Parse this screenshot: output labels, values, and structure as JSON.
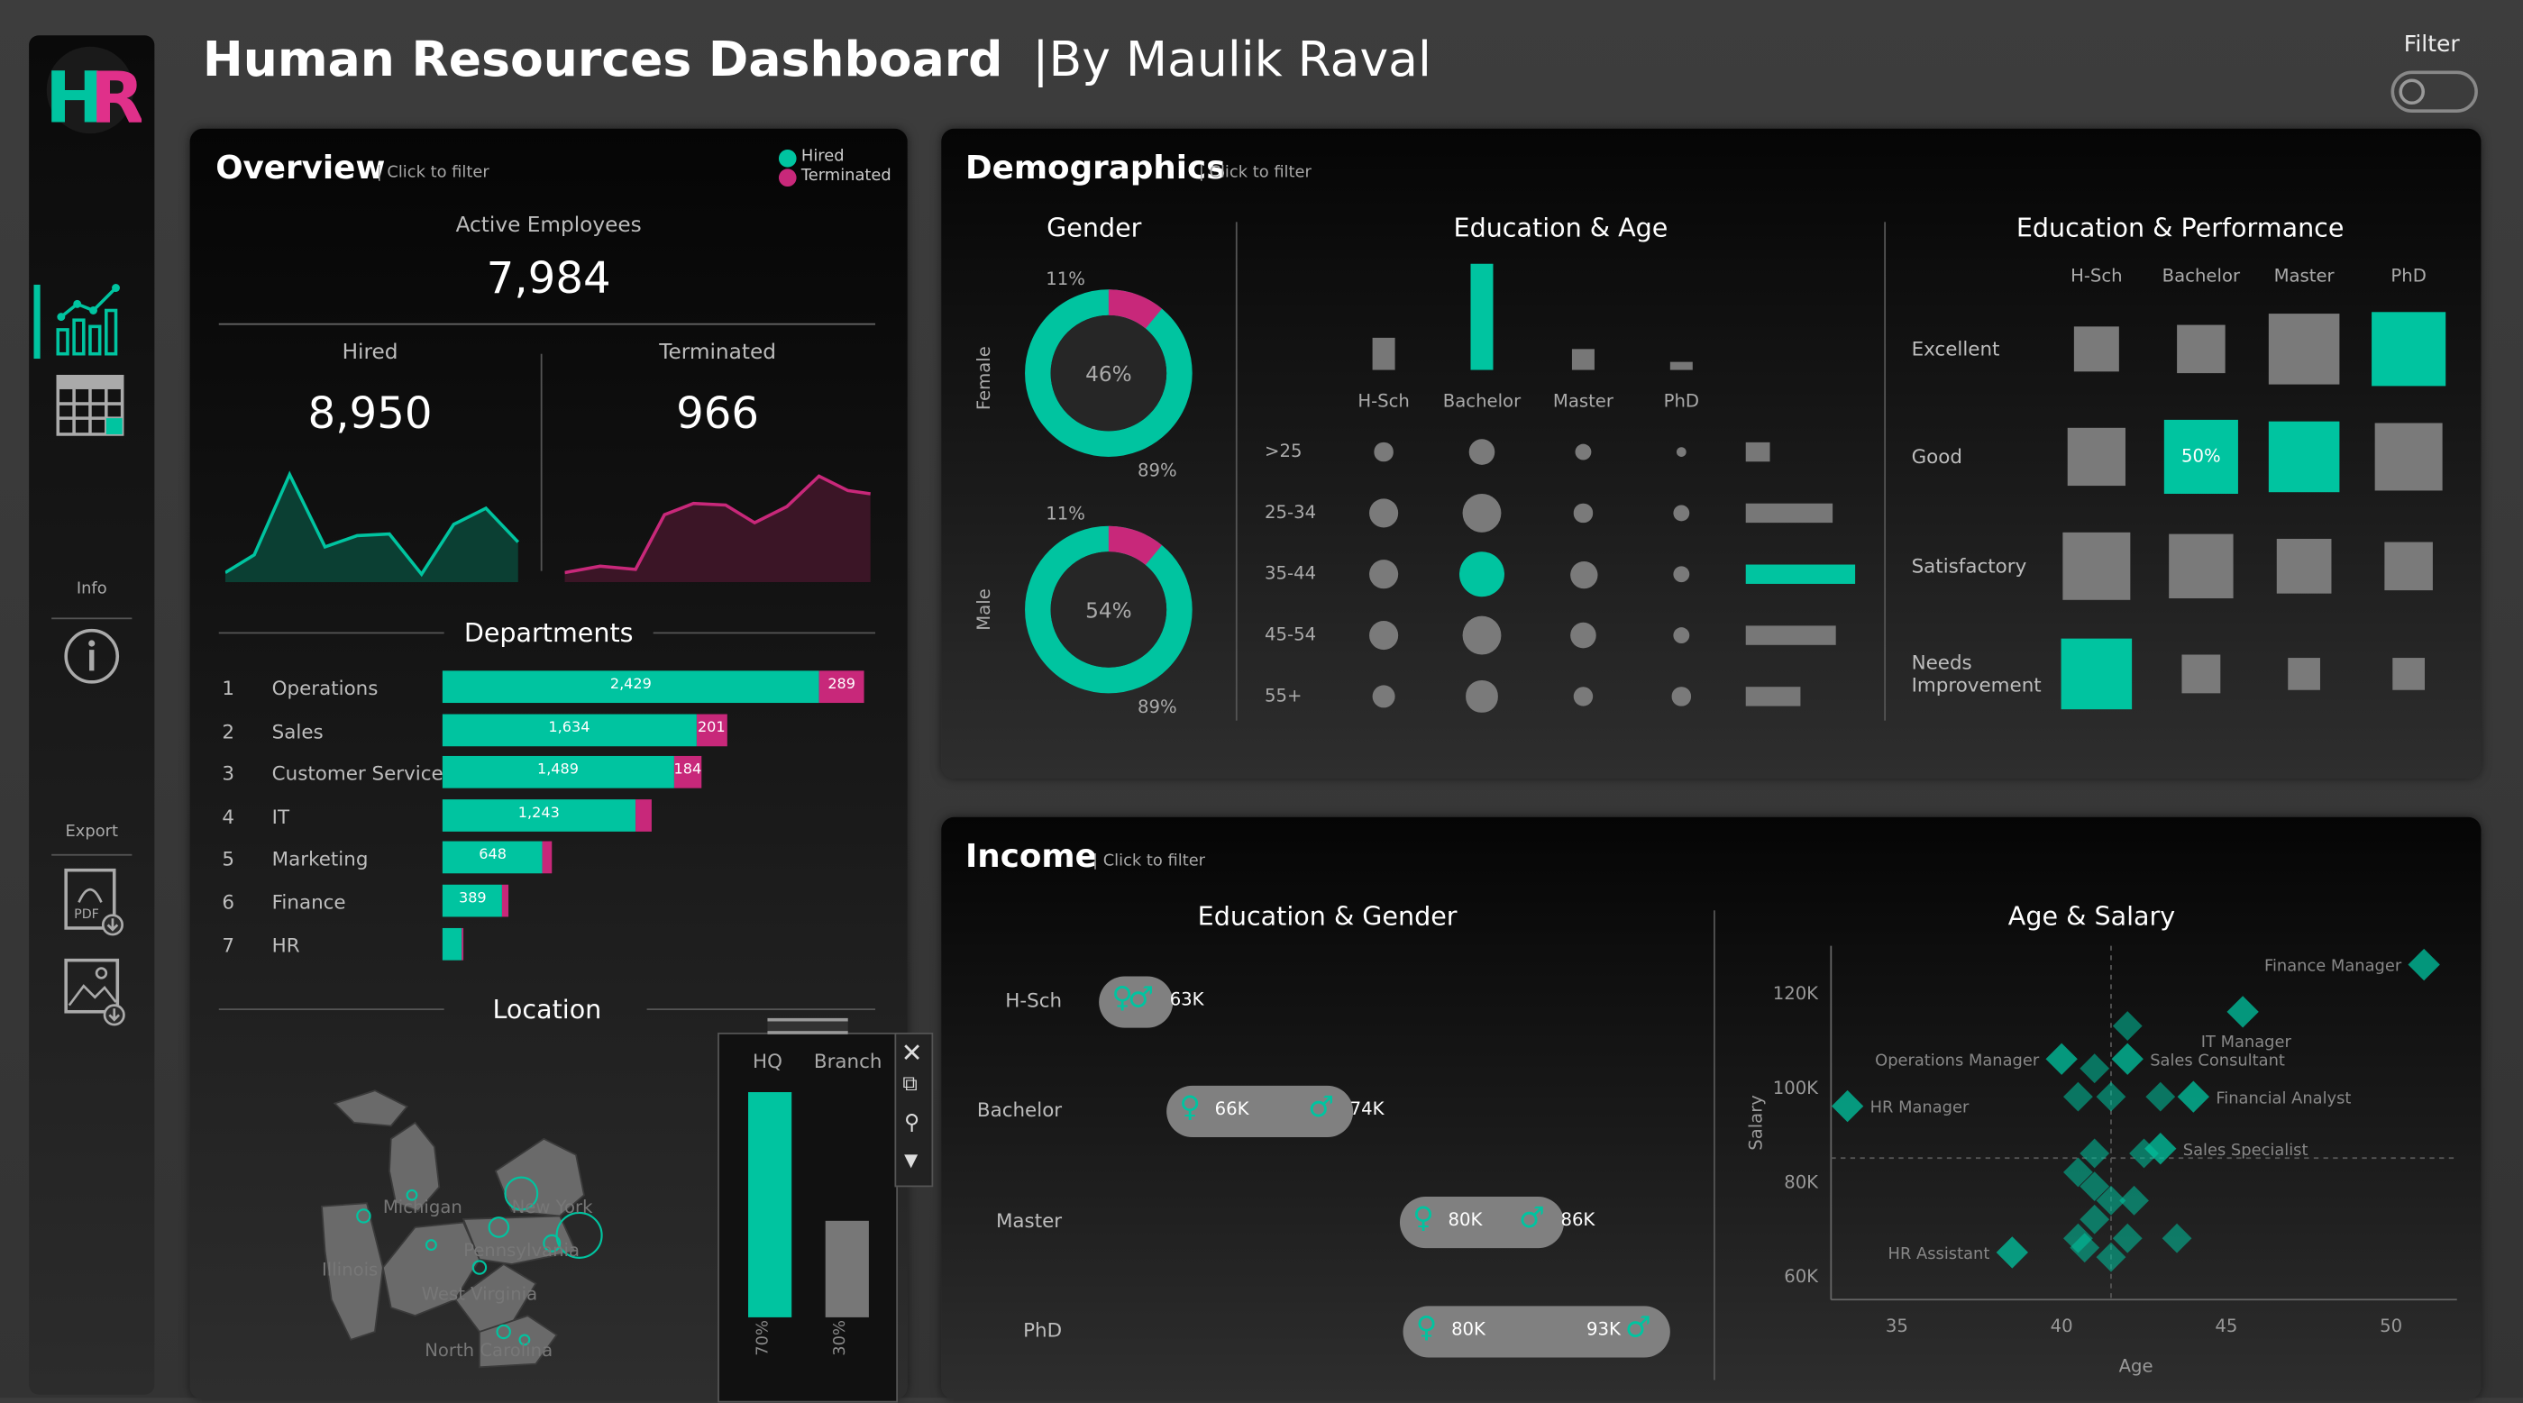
{
  "header": {
    "title": "Human Resources Dashboard",
    "byline": "|By Maulik Raval",
    "filter_label": "Filter"
  },
  "sidebar": {
    "logo_text": "HR",
    "info_label": "Info",
    "export_label": "Export"
  },
  "colors": {
    "teal": "#00c4a0",
    "pink": "#c8287a",
    "grey": "#777777"
  },
  "overview": {
    "title": "Overview",
    "hint": "| Click to filter",
    "legend": {
      "hired": "Hired",
      "terminated": "Terminated"
    },
    "active_label": "Active Employees",
    "active_value": "7,984",
    "hired_label": "Hired",
    "hired_value": "8,950",
    "terminated_label": "Terminated",
    "terminated_value": "966",
    "departments_label": "Departments",
    "departments": [
      {
        "rank": "1",
        "name": "Operations",
        "hired": "2,429",
        "terminated": "289",
        "hired_n": 2429,
        "term_n": 289
      },
      {
        "rank": "2",
        "name": "Sales",
        "hired": "1,634",
        "terminated": "201",
        "hired_n": 1634,
        "term_n": 201
      },
      {
        "rank": "3",
        "name": "Customer Service",
        "hired": "1,489",
        "terminated": "184",
        "hired_n": 1489,
        "term_n": 184
      },
      {
        "rank": "4",
        "name": "IT",
        "hired": "1,243",
        "terminated": "",
        "hired_n": 1243,
        "term_n": 110
      },
      {
        "rank": "5",
        "name": "Marketing",
        "hired": "648",
        "terminated": "",
        "hired_n": 648,
        "term_n": 55
      },
      {
        "rank": "6",
        "name": "Finance",
        "hired": "389",
        "terminated": "",
        "hired_n": 389,
        "term_n": 40
      },
      {
        "rank": "7",
        "name": "HR",
        "hired": "",
        "terminated": "",
        "hired_n": 120,
        "term_n": 20
      }
    ],
    "location_label": "Location",
    "location": {
      "hq_label": "HQ",
      "branch_label": "Branch",
      "hq_pct": "70%",
      "branch_pct": "30%",
      "hq_value": 0.7,
      "branch_value": 0.3
    },
    "map_labels": [
      "Michigan",
      "New York",
      "Illinois",
      "Pennsylvania",
      "West Virginia",
      "North Carolina"
    ]
  },
  "demographics": {
    "title": "Demographics",
    "hint": "| Click to filter",
    "gender": {
      "title": "Gender",
      "female": {
        "label": "Female",
        "center": "46%",
        "top": "11%",
        "bottom": "89%",
        "share": 0.11
      },
      "male": {
        "label": "Male",
        "center": "54%",
        "top": "11%",
        "bottom": "89%",
        "share": 0.11
      }
    },
    "edu_age": {
      "title": "Education & Age",
      "education": [
        "H-Sch",
        "Bachelor",
        "Master",
        "PhD"
      ],
      "ages": [
        ">25",
        "25-34",
        "35-44",
        "45-54",
        "55+"
      ],
      "edu_bar_values": [
        0.3,
        1.0,
        0.2,
        0.08
      ],
      "bubble_sizes": [
        [
          0.25,
          0.45,
          0.2,
          0
        ],
        [
          0.55,
          0.85,
          0.25,
          0.2
        ],
        [
          0.55,
          1.0,
          0.5,
          0.2
        ],
        [
          0.55,
          0.85,
          0.45,
          0.2
        ],
        [
          0.4,
          0.6,
          0.3,
          0.25
        ]
      ],
      "highlight": [
        2,
        1
      ],
      "age_bar_values": [
        0.22,
        0.8,
        1.0,
        0.82,
        0.5
      ]
    },
    "edu_perf": {
      "title": "Education & Performance",
      "education": [
        "H-Sch",
        "Bachelor",
        "Master",
        "PhD"
      ],
      "ratings": [
        "Excellent",
        "Good",
        "Satisfactory",
        "Needs\nImprovement"
      ],
      "rating_lines": [
        [
          "Excellent"
        ],
        [
          "Good"
        ],
        [
          "Satisfactory"
        ],
        [
          "Needs",
          "Improvement"
        ]
      ],
      "cells": [
        [
          0.55,
          0.6,
          0.95,
          1.0
        ],
        [
          0.75,
          1.0,
          0.95,
          0.92
        ],
        [
          0.92,
          0.85,
          0.7,
          0.6
        ],
        [
          0.95,
          0.4,
          0.3,
          0.3
        ]
      ],
      "teal_cells": [
        [
          0,
          3
        ],
        [
          1,
          1
        ],
        [
          1,
          2
        ],
        [
          3,
          0
        ]
      ],
      "highlight_label": "50%"
    }
  },
  "income": {
    "title": "Income",
    "hint": "| Click to filter",
    "edu_gender": {
      "title": "Education & Gender",
      "rows": [
        {
          "label": "H-Sch",
          "first": "",
          "second": "63K"
        },
        {
          "label": "Bachelor",
          "first": "66K",
          "second": "74K"
        },
        {
          "label": "Master",
          "first": "80K",
          "second": "86K"
        },
        {
          "label": "PhD",
          "first": "80K",
          "second": "93K"
        }
      ]
    },
    "age_salary": {
      "title": "Age & Salary",
      "xlabel": "Age",
      "ylabel": "Salary",
      "x_ticks": [
        "35",
        "40",
        "45",
        "50"
      ],
      "y_ticks": [
        "120K",
        "100K",
        "80K",
        "60K"
      ],
      "xlim": [
        33,
        52
      ],
      "ylim": [
        55,
        130
      ],
      "labeled_points": [
        {
          "name": "Finance Manager",
          "x": 51,
          "y": 126
        },
        {
          "name": "IT Manager",
          "x": 45.5,
          "y": 116
        },
        {
          "name": "Operations Manager",
          "x": 40,
          "y": 106
        },
        {
          "name": "Sales Consultant",
          "x": 42,
          "y": 106
        },
        {
          "name": "Financial Analyst",
          "x": 44,
          "y": 98
        },
        {
          "name": "HR Manager",
          "x": 33.5,
          "y": 96
        },
        {
          "name": "Sales Specialist",
          "x": 43,
          "y": 87
        },
        {
          "name": "HR Assistant",
          "x": 38.5,
          "y": 65
        }
      ],
      "points": [
        [
          42,
          113
        ],
        [
          41,
          104
        ],
        [
          43,
          98
        ],
        [
          40.5,
          98
        ],
        [
          41.5,
          98
        ],
        [
          42.5,
          86
        ],
        [
          41,
          86
        ],
        [
          40.5,
          82
        ],
        [
          41,
          79
        ],
        [
          41.5,
          76
        ],
        [
          41,
          72
        ],
        [
          40.5,
          68
        ],
        [
          42,
          68
        ],
        [
          41.5,
          64
        ],
        [
          40.7,
          66
        ],
        [
          42.2,
          76
        ],
        [
          43.5,
          68
        ]
      ]
    }
  }
}
